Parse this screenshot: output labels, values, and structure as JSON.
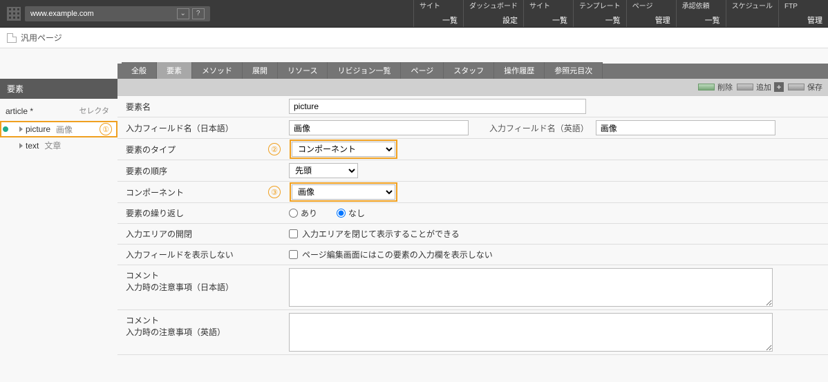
{
  "topbar": {
    "site_url": "www.example.com",
    "menu": [
      {
        "top": "サイト",
        "bottom": "一覧"
      },
      {
        "top": "ダッシュボード",
        "bottom": "設定"
      },
      {
        "top": "サイト",
        "bottom": "一覧"
      },
      {
        "top": "テンプレート",
        "bottom": "一覧"
      },
      {
        "top": "ページ",
        "bottom": "管理"
      },
      {
        "top": "承認依頼",
        "bottom": "一覧"
      },
      {
        "top": "スケジュール",
        "bottom": ""
      },
      {
        "top": "FTP",
        "bottom": "管理"
      }
    ]
  },
  "subhead": {
    "title": "汎用ページ"
  },
  "sidebar": {
    "heading": "要素",
    "group_label": "article *",
    "selector_label": "セレクタ",
    "items": [
      {
        "name": "picture",
        "sub": "画像",
        "callout": "①",
        "selected": true
      },
      {
        "name": "text",
        "sub": "文章",
        "callout": "",
        "selected": false
      }
    ]
  },
  "tabs": [
    "全般",
    "要素",
    "メソッド",
    "展開",
    "リソース",
    "リビジョン一覧",
    "ページ",
    "スタッフ",
    "操作履歴",
    "参照元目次"
  ],
  "active_tab": "要素",
  "actions": {
    "delete": "削除",
    "add": "追加",
    "save": "保存"
  },
  "form": {
    "element_name": {
      "label": "要素名",
      "value": "picture"
    },
    "input_field_ja": {
      "label": "入力フィールド名（日本語）",
      "value": "画像"
    },
    "input_field_en": {
      "label": "入力フィールド名（英語）",
      "value": "画像"
    },
    "element_type": {
      "label": "要素のタイプ",
      "value": "コンポーネント",
      "callout": "②"
    },
    "element_order": {
      "label": "要素の順序",
      "value": "先頭"
    },
    "component": {
      "label": "コンポーネント",
      "value": "画像",
      "callout": "③"
    },
    "repeat": {
      "label": "要素の繰り返し",
      "yes": "あり",
      "no": "なし",
      "selected": "no"
    },
    "collapse": {
      "label": "入力エリアの開閉",
      "check_label": "入力エリアを閉じて表示することができる"
    },
    "hide_field": {
      "label": "入力フィールドを表示しない",
      "check_label": "ページ編集画面にはこの要素の入力欄を表示しない"
    },
    "comment_ja": {
      "label1": "コメント",
      "label2": "入力時の注意事項（日本語）",
      "value": ""
    },
    "comment_en": {
      "label1": "コメント",
      "label2": "入力時の注意事項（英語）",
      "value": ""
    }
  }
}
